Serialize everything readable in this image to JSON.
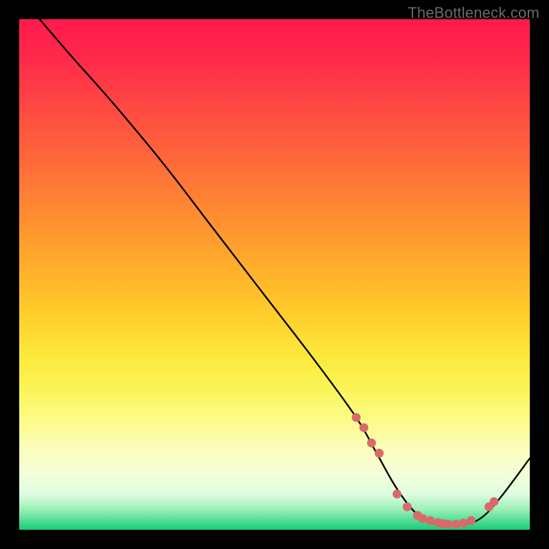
{
  "watermark": "TheBottleneck.com",
  "chart_data": {
    "type": "line",
    "title": "",
    "xlabel": "",
    "ylabel": "",
    "xlim": [
      0,
      100
    ],
    "ylim": [
      0,
      100
    ],
    "series": [
      {
        "name": "curve",
        "x": [
          4,
          10,
          18,
          28,
          38,
          48,
          58,
          66,
          70,
          74,
          78,
          82,
          86,
          90,
          94,
          100
        ],
        "values": [
          100,
          93,
          84,
          72,
          59,
          46,
          33,
          22,
          15,
          8,
          3,
          1,
          1,
          2,
          6,
          14
        ]
      }
    ],
    "scatter_points": {
      "name": "markers",
      "color": "#d86a6a",
      "x": [
        66,
        67.5,
        69,
        70.5,
        74,
        76,
        78,
        79,
        80.5,
        82,
        83,
        84,
        85.5,
        87,
        88.5,
        92,
        93
      ],
      "values": [
        22,
        20,
        17,
        15,
        7,
        4.5,
        2.8,
        2.2,
        1.8,
        1.4,
        1.2,
        1.1,
        1.1,
        1.3,
        1.8,
        4.5,
        5.5
      ]
    }
  }
}
